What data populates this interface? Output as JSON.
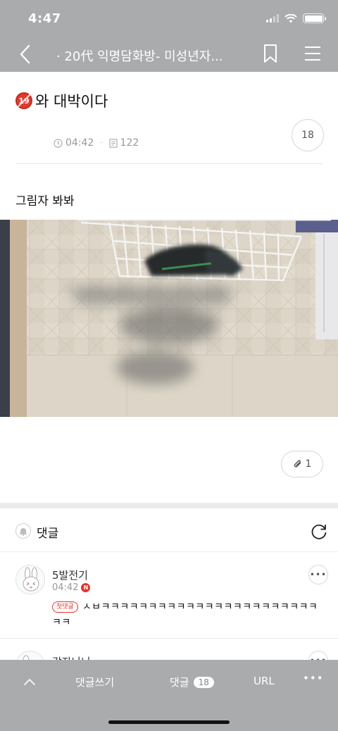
{
  "status_bar": {
    "time": "4:47"
  },
  "header": {
    "title": "· 20代 익명담화방- 미성년자..."
  },
  "post": {
    "age_badge": "19",
    "title": "와 대박이다",
    "time": "04:42",
    "views": "122",
    "comment_count": "18",
    "body": "그림자 봐봐",
    "attachment_count": "1"
  },
  "comments_section": {
    "label": "댓글",
    "items": [
      {
        "author": "5발전기",
        "time": "04:42",
        "new_badge": "N",
        "first_badge": "첫댓글",
        "text": "ㅅㅂㅋㅋㅋㅋㅋㅋㅋㅋㅋㅋㅋㅋㅋㅋㅋㅋㅋㅋㅋㅋㅋㅋㅋㅋㅋ"
      },
      {
        "author": "감자나나"
      }
    ]
  },
  "bottom_bar": {
    "write_label": "댓글쓰기",
    "comments_label": "댓글",
    "comments_badge": "18",
    "url_label": "URL",
    "more_label": "•••"
  },
  "icons": {
    "back": "chevron-left-icon",
    "bookmark": "bookmark-icon",
    "menu": "hamburger-menu-icon",
    "clock": "clock-icon",
    "document": "document-icon",
    "paperclip": "paperclip-icon",
    "bell": "bell-icon",
    "refresh": "refresh-icon",
    "up": "chevron-up-icon"
  },
  "colors": {
    "overlay_gray": "#a9abad",
    "badge_red": "#e6322a",
    "separator": "#ececec"
  }
}
